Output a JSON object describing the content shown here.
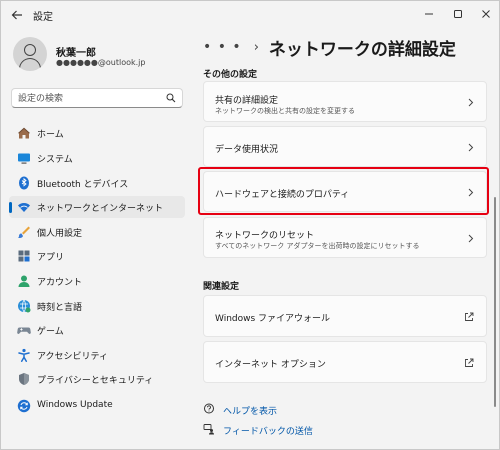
{
  "window": {
    "title": "設定"
  },
  "profile": {
    "name": "秋葉一郎",
    "email": "●●●●●●@outlook.jp"
  },
  "search": {
    "placeholder": "設定の検索"
  },
  "sidebar": {
    "items": [
      {
        "label": "ホーム",
        "icon": "home-icon"
      },
      {
        "label": "システム",
        "icon": "system-icon"
      },
      {
        "label": "Bluetooth とデバイス",
        "icon": "bluetooth-icon"
      },
      {
        "label": "ネットワークとインターネット",
        "icon": "network-icon",
        "selected": true
      },
      {
        "label": "個人用設定",
        "icon": "brush-icon"
      },
      {
        "label": "アプリ",
        "icon": "apps-icon"
      },
      {
        "label": "アカウント",
        "icon": "account-icon"
      },
      {
        "label": "時刻と言語",
        "icon": "time-language-icon"
      },
      {
        "label": "ゲーム",
        "icon": "gamepad-icon"
      },
      {
        "label": "アクセシビリティ",
        "icon": "accessibility-icon"
      },
      {
        "label": "プライバシーとセキュリティ",
        "icon": "shield-icon"
      },
      {
        "label": "Windows Update",
        "icon": "windows-update-icon"
      }
    ]
  },
  "main": {
    "breadcrumb_more": "• • •",
    "breadcrumb_sep": "›",
    "title": "ネットワークの詳細設定",
    "other_section": {
      "title": "その他の設定",
      "items": [
        {
          "title": "共有の詳細設定",
          "subtitle": "ネットワークの検出と共有の設定を変更する"
        },
        {
          "title": "データ使用状況"
        },
        {
          "title": "ハードウェアと接続のプロパティ"
        },
        {
          "title": "ネットワークのリセット",
          "subtitle": "すべてのネットワーク アダプターを出荷時の設定にリセットする"
        }
      ]
    },
    "related_section": {
      "title": "関連設定",
      "items": [
        {
          "title": "Windows ファイアウォール"
        },
        {
          "title": "インターネット オプション"
        }
      ]
    },
    "links": [
      {
        "label": "ヘルプを表示",
        "icon": "help-icon"
      },
      {
        "label": "フィードバックの送信",
        "icon": "feedback-icon"
      }
    ]
  },
  "colors": {
    "accent": "#0067c0",
    "highlight": "#e60012",
    "link": "#0056a8"
  }
}
